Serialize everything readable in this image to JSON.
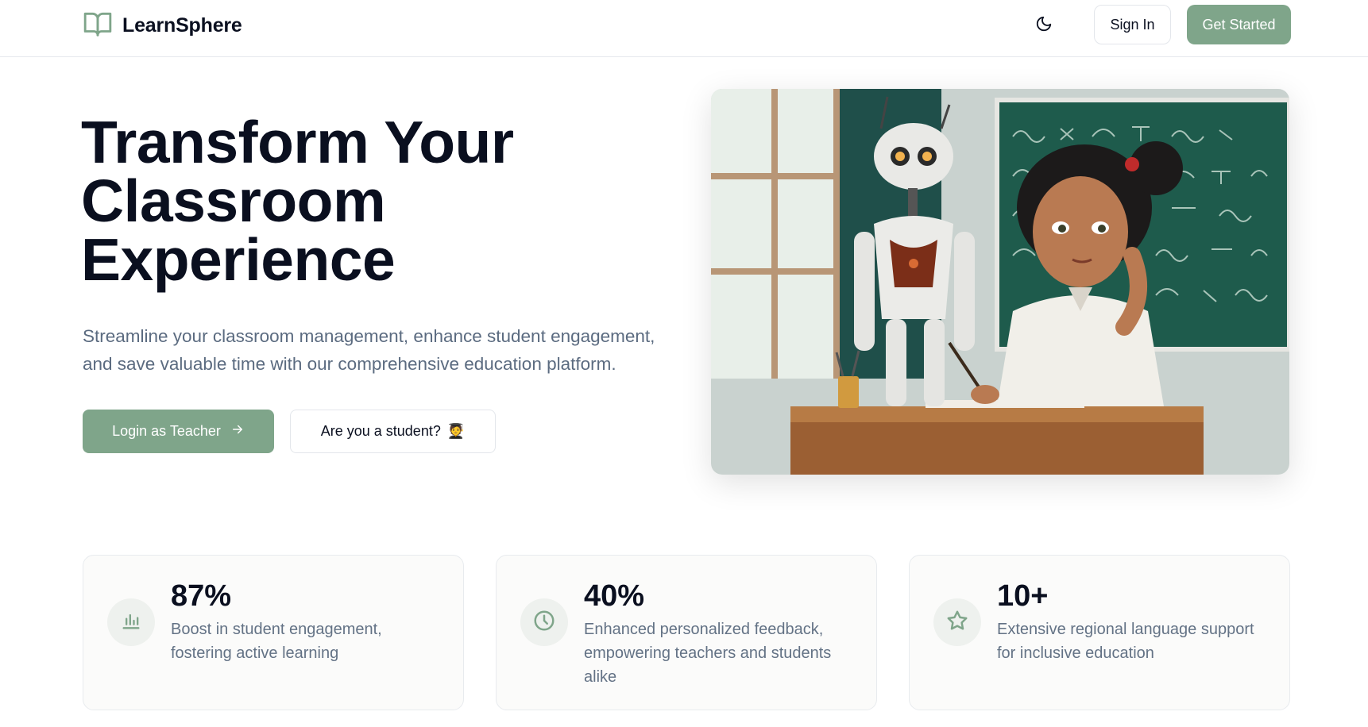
{
  "header": {
    "brand": "LearnSphere",
    "signin_label": "Sign In",
    "get_started_label": "Get Started",
    "theme_icon": "moon-icon"
  },
  "hero": {
    "title_line1": "Transform Your",
    "title_line2": "Classroom",
    "title_line3": "Experience",
    "subtitle": "Streamline your classroom management, enhance student engagement, and save valuable time with our comprehensive education platform.",
    "teacher_button": "Login as Teacher",
    "student_button": "Are you a student?",
    "student_emoji": "🧑‍🎓"
  },
  "stats": [
    {
      "value": "87%",
      "description": "Boost in student engagement, fostering active learning",
      "icon": "bar-chart-icon"
    },
    {
      "value": "40%",
      "description": "Enhanced personalized feedback, empowering teachers and students alike",
      "icon": "clock-icon"
    },
    {
      "value": "10+",
      "description": "Extensive regional language support for inclusive education",
      "icon": "star-icon"
    }
  ],
  "colors": {
    "accent": "#7fa58a",
    "text_dark": "#0a0f1f",
    "text_muted": "#5b6b80"
  }
}
